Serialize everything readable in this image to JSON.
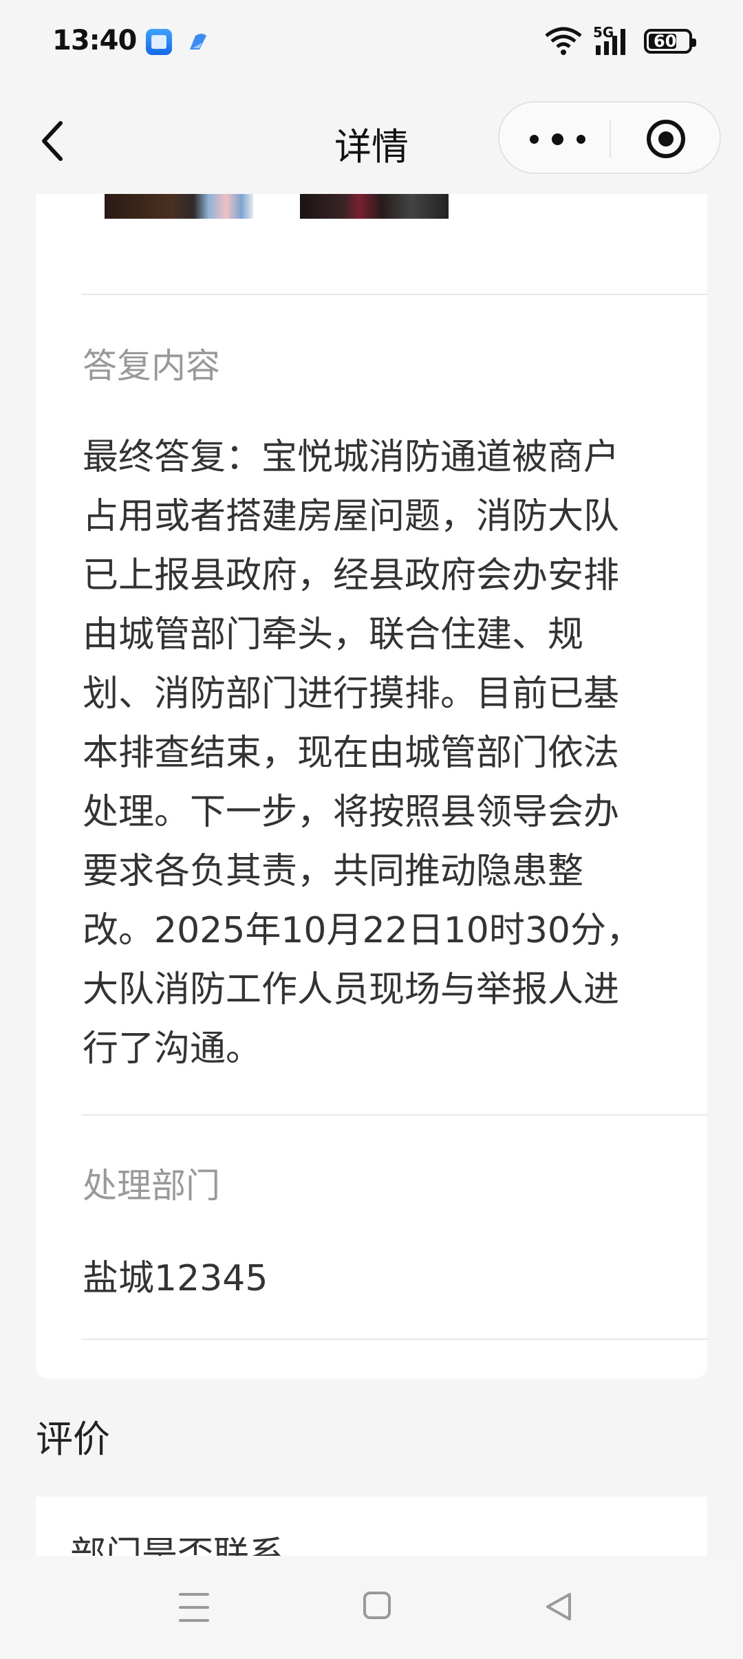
{
  "status_bar": {
    "time": "13:40",
    "network": "5G",
    "battery": "60"
  },
  "nav": {
    "title": "详情",
    "icons": [
      "back-arrow-icon",
      "more-dots-icon",
      "close-target-icon"
    ]
  },
  "detail": {
    "reply_label": "答复内容",
    "reply_content": "最终答复：宝悦城消防通道被商户占用或者搭建房屋问题，消防大队已上报县政府，经县政府会办安排由城管部门牵头，联合住建、规划、消防部门进行摸排。目前已基本排查结束，现在由城管部门依法处理。下一步，将按照县领导会办要求各负其责，共同推动隐患整改。2025年10月22日10时30分，大队消防工作人员现场与举报人进行了沟通。",
    "dept_label": "处理部门",
    "dept_value": "盐城12345"
  },
  "evaluation": {
    "title": "评价",
    "question": "部门是否联系"
  },
  "system_nav": {
    "icons": [
      "menu-icon",
      "home-icon",
      "back-icon"
    ]
  }
}
